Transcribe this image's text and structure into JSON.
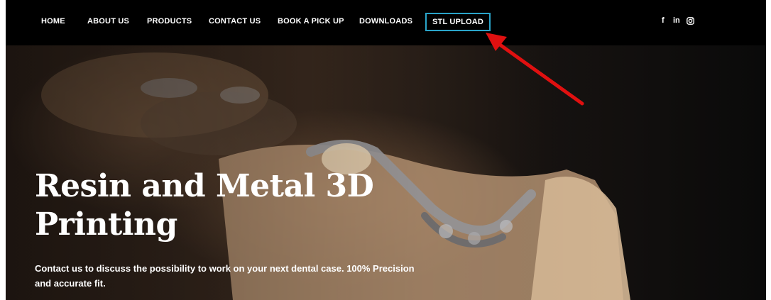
{
  "nav": {
    "items": [
      {
        "label": "HOME"
      },
      {
        "label": "ABOUT US"
      },
      {
        "label": "PRODUCTS"
      },
      {
        "label": "CONTACT US"
      },
      {
        "label": "BOOK A PICK UP"
      },
      {
        "label": "DOWNLOADS"
      },
      {
        "label": "STL UPLOAD",
        "highlighted": true
      }
    ],
    "highlight_color": "#2aa4c9",
    "social": [
      {
        "icon": "facebook-icon",
        "glyph": "f"
      },
      {
        "icon": "linkedin-icon",
        "glyph": "in"
      },
      {
        "icon": "instagram-icon"
      }
    ]
  },
  "hero": {
    "title_line1": "Resin and Metal 3D",
    "title_line2": "Printing",
    "text": "Contact us to discuss the possibility to work on your next dental case. 100% Precision and accurate fit."
  },
  "annotation": {
    "icon": "red-arrow-icon",
    "color": "#e01010"
  }
}
